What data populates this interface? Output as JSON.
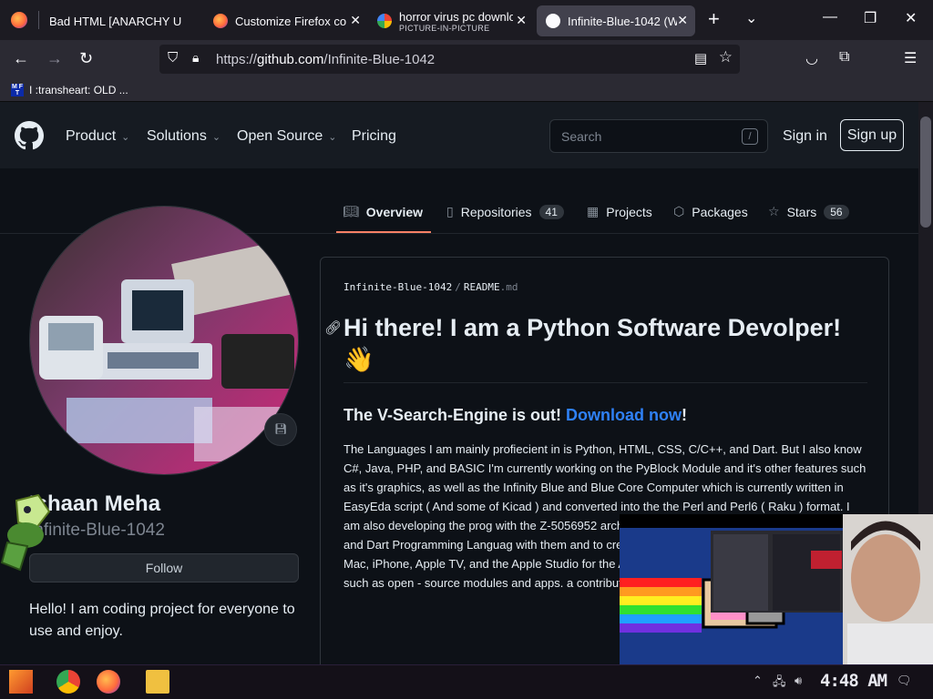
{
  "browser": {
    "tabs": [
      {
        "title": "Bad HTML [ANARCHY US",
        "active": false
      },
      {
        "title": "Customize Firefox co",
        "active": false
      },
      {
        "title": "horror virus pc downlo",
        "subtitle": "PICTURE-IN-PICTURE",
        "active": false
      },
      {
        "title": "Infinite-Blue-1042 (W",
        "active": true
      }
    ],
    "new_tab_label": "+",
    "url_scheme": "https://",
    "url_host": "github.com",
    "url_path": "/Infinite-Blue-1042",
    "bookmark": "I :transheart: OLD ..."
  },
  "github": {
    "nav": [
      "Product",
      "Solutions",
      "Open Source",
      "Pricing"
    ],
    "search_placeholder": "Search",
    "search_key": "/",
    "sign_in": "Sign in",
    "sign_up": "Sign up",
    "tabs": [
      {
        "label": "Overview",
        "count": null
      },
      {
        "label": "Repositories",
        "count": "41"
      },
      {
        "label": "Projects",
        "count": null
      },
      {
        "label": "Packages",
        "count": null
      },
      {
        "label": "Stars",
        "count": "56"
      }
    ]
  },
  "profile": {
    "name": "Ishaan Meha",
    "username": "Infinite-Blue-1042",
    "follow": "Follow",
    "bio": "Hello! I am coding project for everyone to use and enjoy."
  },
  "readme": {
    "path_user": "Infinite-Blue-1042",
    "path_sep": "/",
    "path_file": "README",
    "path_ext": ".md",
    "h1": "Hi there! I am a Python Software Devolper! 👋",
    "h3_prefix": "The V-Search-Engine is out! ",
    "h3_link": "Download now",
    "h3_suffix": "!",
    "paragraph": "The Languages I am mainly profiecient in is Python, HTML, CSS, C/C++, and Dart. But I also know C#, Java, PHP, and BASIC I'm currently working on the PyBlock Module and it's other features such as it's graphics, as well as the Infinity Blue and Blue Core Computer which is currently written in EasyEda script ( And some of Kicad ) and converted into the the Perl and Perl6 ( Raku ) format. I am also developing the prog with the Z-5056952 architecture compImenting the learning the Java and Dart Programming Languag with them and to create useful applications. I use S apps for the Mac, iPhone, Apple TV, and the Apple Studio for the Apps in the Android OS made by Go projects such as open - source modules and apps. a contributer to any repositore with my permissio"
  },
  "taskbar": {
    "clock": "4:48 AM"
  },
  "colors": {
    "accent_link": "#2f81f7",
    "tab_underline": "#f78166",
    "page_bg": "#0d1117",
    "header_bg": "#161b22"
  }
}
